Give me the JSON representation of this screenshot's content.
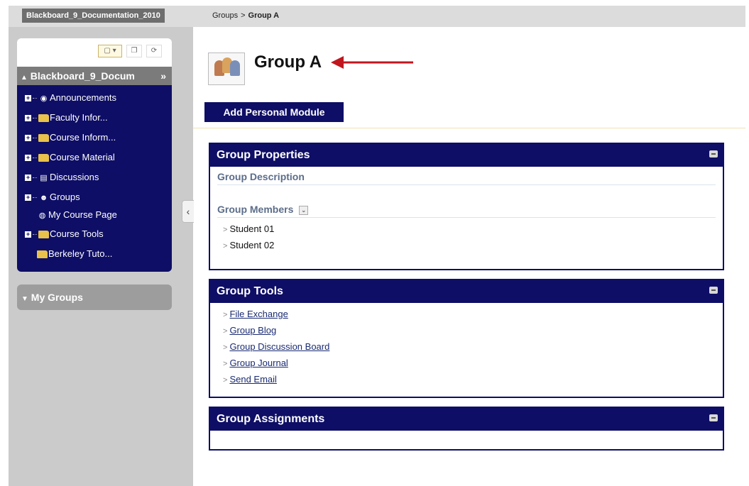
{
  "breadcrumb": {
    "course": "Blackboard_9_Documentation_2010",
    "parent": "Groups",
    "separator": ">",
    "current": "Group A"
  },
  "sidebar": {
    "course_title": "Blackboard_9_Docum",
    "course_title_marker": "»",
    "items": [
      {
        "label": "Announcements",
        "icon": "announcement-icon"
      },
      {
        "label": "Faculty Infor...",
        "icon": "folder-icon"
      },
      {
        "label": "Course Inform...",
        "icon": "folder-icon"
      },
      {
        "label": "Course Material",
        "icon": "folder-icon"
      },
      {
        "label": "Discussions",
        "icon": "discussion-icon"
      },
      {
        "label": "Groups",
        "icon": "groups-icon"
      },
      {
        "label": "My Course Page",
        "icon": "globe-icon"
      },
      {
        "label": "Course Tools",
        "icon": "folder-icon"
      },
      {
        "label": "Berkeley Tuto...",
        "icon": "folder-icon"
      }
    ],
    "my_groups": "My Groups"
  },
  "main": {
    "title": "Group A",
    "add_module_label": "Add Personal Module",
    "group_properties": {
      "title": "Group Properties",
      "description_heading": "Group Description",
      "members_heading": "Group Members",
      "members": [
        "Student 01",
        "Student 02"
      ]
    },
    "group_tools": {
      "title": "Group Tools",
      "tools": [
        "File Exchange",
        "Group Blog",
        "Group Discussion Board",
        "Group Journal",
        "Send Email"
      ]
    },
    "group_assignments": {
      "title": "Group Assignments"
    }
  },
  "colors": {
    "navy": "#0e0e66",
    "folder": "#e8c24a",
    "arrow": "#c0171f"
  }
}
